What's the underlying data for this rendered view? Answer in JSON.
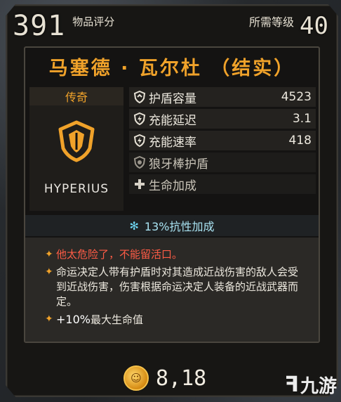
{
  "header": {
    "score_value": "391",
    "score_label": "物品评分",
    "level_label": "所需等级",
    "level_value": "40"
  },
  "item": {
    "name": "马塞德 · 瓦尔杜 （结实）",
    "rarity": "传奇",
    "manufacturer": "HYPERIUS",
    "icon": "shield-crest-icon"
  },
  "stats": [
    {
      "icon": "shield-capacity-icon",
      "label": "护盾容量",
      "value": "4523"
    },
    {
      "icon": "recharge-delay-icon",
      "label": "充能延迟",
      "value": "3.1"
    },
    {
      "icon": "recharge-rate-icon",
      "label": "充能速率",
      "value": "418"
    },
    {
      "icon": "spike-shield-icon",
      "label": "狼牙棒护盾",
      "value": ""
    },
    {
      "icon": "health-plus-icon",
      "label": "生命加成",
      "value": ""
    }
  ],
  "resist": {
    "icon": "snowflake-icon",
    "text": "13%抗性加成"
  },
  "description": {
    "flavor": "他太危险了，不能留活口。",
    "effect": "命运决定人带有护盾时对其造成近战伤害的敌人会受到近战伤害，伤害根据命运决定人装备的近战武器而定。",
    "bonus_value": "+10%",
    "bonus_text": "最大生命值"
  },
  "price": {
    "icon": "coin-icon",
    "value": "8,18"
  },
  "watermark": {
    "icon": "jiuyou-logo-icon",
    "text": "九游"
  },
  "colors": {
    "legendary": "#f0a22a",
    "flavor": "#ff5c46",
    "cryo": "#6fd8f5"
  }
}
